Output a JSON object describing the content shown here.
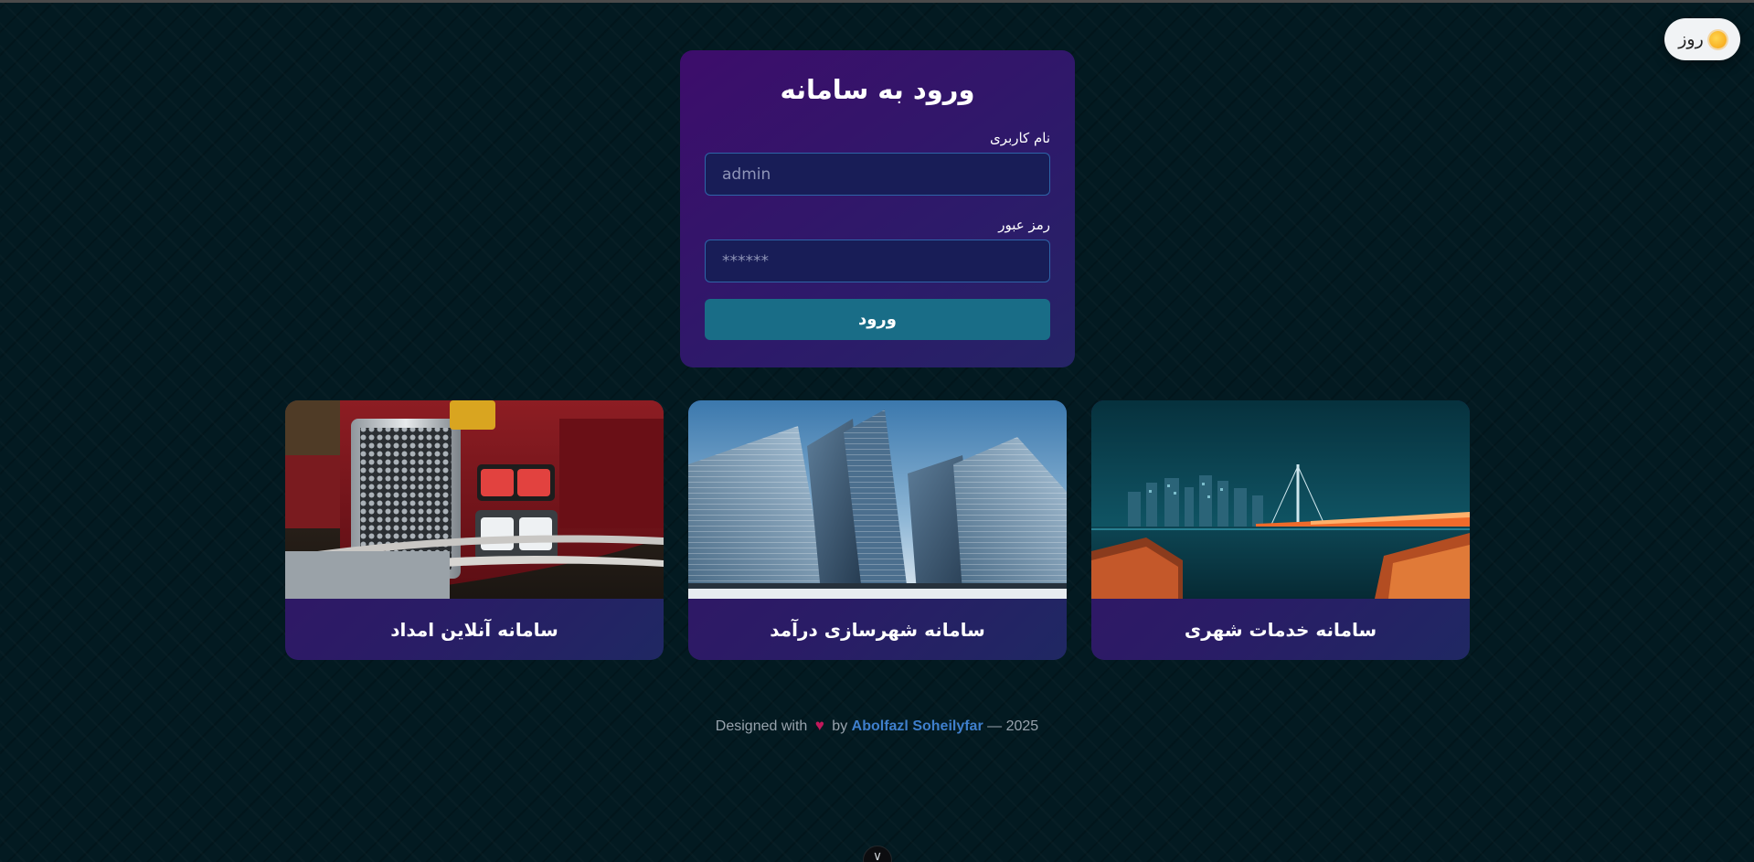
{
  "theme_toggle": {
    "label": "روز",
    "icon": "sun-icon"
  },
  "login": {
    "title": "ورود به سامانه",
    "username_label": "نام کاربری",
    "username_placeholder": "admin",
    "password_label": "رمز عبور",
    "password_placeholder": "******",
    "submit_label": "ورود"
  },
  "services": [
    {
      "title": "سامانه آنلاین امداد",
      "image": "fire-truck-photo"
    },
    {
      "title": "سامانه شهرسازی درآمد",
      "image": "skyscrapers-photo"
    },
    {
      "title": "سامانه خدمات شهری",
      "image": "city-night-bridge-photo"
    }
  ],
  "footer": {
    "prefix": "Designed with",
    "heart": "♥",
    "by": "by",
    "author": "Abolfazl Soheilyfar",
    "suffix": "— 2025"
  },
  "bottom_badge": {
    "icon": "chevron-down-icon",
    "glyph": "∨"
  },
  "colors": {
    "background": "#031a21",
    "card_gradient_start": "#3d0d6b",
    "card_gradient_end": "#252466",
    "input_border": "#2e64a8",
    "button": "#196d87",
    "author_link": "#3f7fcc",
    "heart": "#c2185b"
  }
}
